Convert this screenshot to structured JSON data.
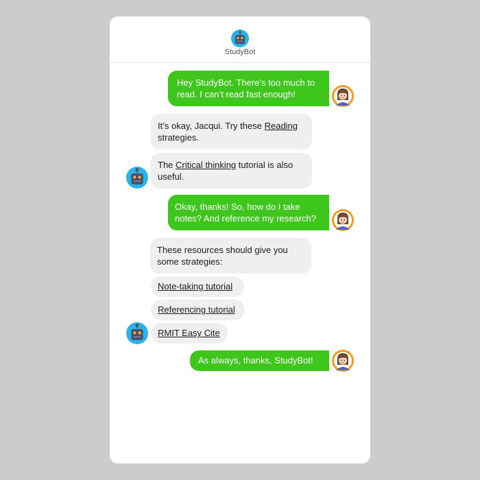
{
  "bot": {
    "name": "StudyBot"
  },
  "messages": {
    "m1": {
      "text": "Hey StudyBot. There’s too much to read. I can’t read fast enough!"
    },
    "m2": {
      "before": "It’s okay, Jacqui. Try these ",
      "link": "Reading",
      "after": " strategies."
    },
    "m3": {
      "before": "The ",
      "link": "Critical thinking",
      "after": " tutorial is also useful."
    },
    "m4": {
      "text": "Okay, thanks! So, how do I take notes? And reference my research?"
    },
    "m5": {
      "text": "These resources should give you some strategies:"
    },
    "m6": {
      "link": "Note-taking tutorial"
    },
    "m7": {
      "link": "Referencing tutorial"
    },
    "m8": {
      "link": "RMIT Easy Cite"
    },
    "m9": {
      "text": "As always, thanks, StudyBot!"
    }
  },
  "colors": {
    "page_background": "#cccccc",
    "outgoing_bubble": "#3ec61c",
    "incoming_bubble": "#efefef",
    "bot_face": "#2ab3e8",
    "user_avatar_ring": "#f49a1d"
  }
}
